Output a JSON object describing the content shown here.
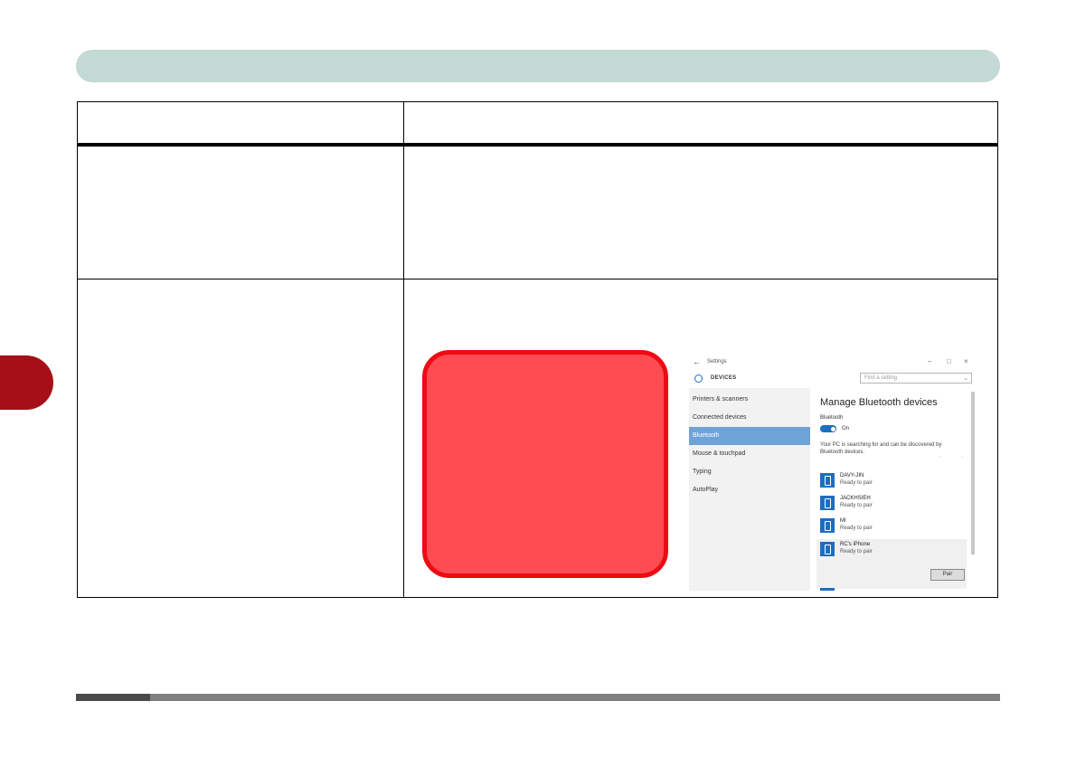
{
  "settings_window": {
    "title": "Settings",
    "section": "DEVICES",
    "search_placeholder": "Find a setting",
    "nav_items": [
      {
        "label": "Printers & scanners"
      },
      {
        "label": "Connected devices"
      },
      {
        "label": "Bluetooth"
      },
      {
        "label": "Mouse & touchpad"
      },
      {
        "label": "Typing"
      },
      {
        "label": "AutoPlay"
      }
    ],
    "content": {
      "heading": "Manage Bluetooth devices",
      "bluetooth_label": "Bluetooth",
      "toggle_state": "On",
      "searching_text": "Your PC is searching for and can be discovered by Bluetooth devices.",
      "devices": [
        {
          "name": "DAVY-JIN",
          "status": "Ready to pair"
        },
        {
          "name": "JACKHSIEH",
          "status": "Ready to pair"
        },
        {
          "name": "MI",
          "status": "Ready to pair"
        },
        {
          "name": "RC's iPhone",
          "status": "Ready to pair"
        }
      ],
      "pair_label": "Pair"
    }
  },
  "colors": {
    "header_bar": "#c3d9d3",
    "side_tab": "#a60f17",
    "callout_fill": "#ff4c52",
    "callout_border": "#ee0a14",
    "accent_blue": "#1f6dc0"
  }
}
